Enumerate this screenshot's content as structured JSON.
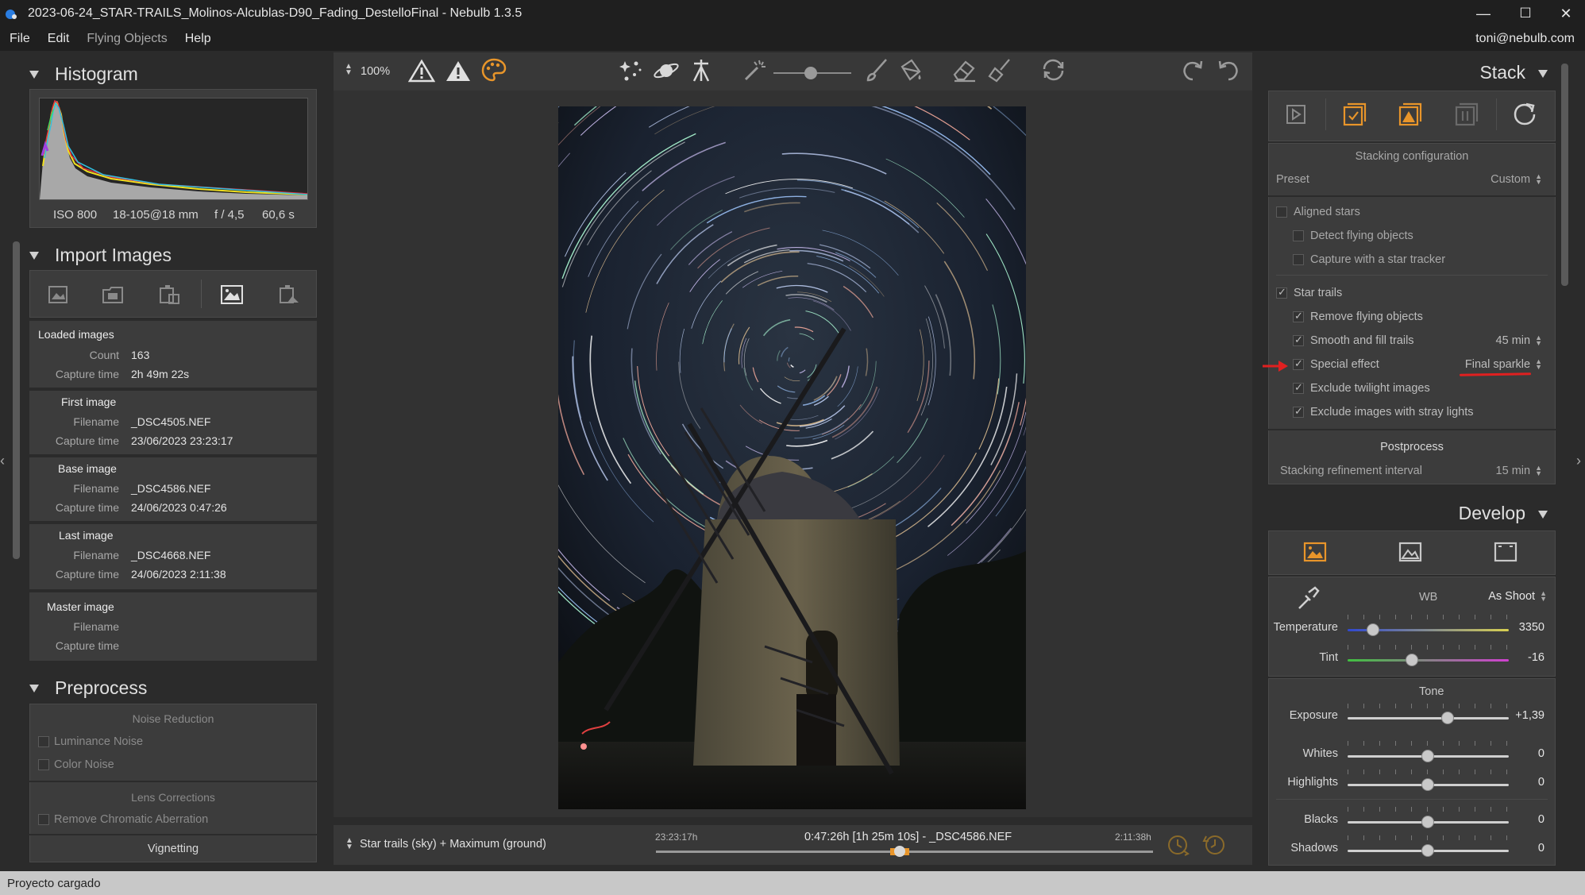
{
  "window": {
    "title": "2023-06-24_STAR-TRAILS_Molinos-Alcublas-D90_Fading_DestelloFinal - Nebulb 1.3.5",
    "minimize": "—",
    "maximize": "☐",
    "close": "✕"
  },
  "menu": {
    "file": "File",
    "edit": "Edit",
    "flying_objects": "Flying Objects",
    "help": "Help",
    "user": "toni@nebulb.com"
  },
  "histogram": {
    "title": "Histogram",
    "iso": "ISO 800",
    "lens": "18-105@18 mm",
    "aperture": "f / 4,5",
    "exposure": "60,6 s"
  },
  "import": {
    "title": "Import Images",
    "loaded": {
      "heading": "Loaded images",
      "count_label": "Count",
      "count": "163",
      "capture_label": "Capture time",
      "capture": "2h 49m 22s"
    },
    "first": {
      "heading": "First image",
      "filename_label": "Filename",
      "filename": "_DSC4505.NEF",
      "capture_label": "Capture time",
      "capture": "23/06/2023 23:23:17"
    },
    "base": {
      "heading": "Base image",
      "filename_label": "Filename",
      "filename": "_DSC4586.NEF",
      "capture_label": "Capture time",
      "capture": "24/06/2023 0:47:26"
    },
    "last": {
      "heading": "Last image",
      "filename_label": "Filename",
      "filename": "_DSC4668.NEF",
      "capture_label": "Capture time",
      "capture": "24/06/2023 2:11:38"
    },
    "master": {
      "heading": "Master image",
      "filename_label": "Filename",
      "capture_label": "Capture time"
    }
  },
  "preprocess": {
    "title": "Preprocess",
    "noise_heading": "Noise Reduction",
    "luminance": "Luminance Noise",
    "color": "Color Noise",
    "lens_heading": "Lens Corrections",
    "chromatic": "Remove Chromatic Aberration",
    "vignetting": "Vignetting"
  },
  "toolbar": {
    "zoom": "100%"
  },
  "bottom": {
    "mode": "Star trails (sky) + Maximum (ground)",
    "start_time": "23:23:17h",
    "current": "0:47:26h [1h 25m 10s] - _DSC4586.NEF",
    "end_time": "2:11:38h",
    "timeline_position": 0.49
  },
  "stack": {
    "title": "Stack",
    "config_heading": "Stacking configuration",
    "preset_label": "Preset",
    "preset_value": "Custom",
    "aligned_stars": "Aligned stars",
    "detect_flying": "Detect flying objects",
    "star_tracker": "Capture with a star tracker",
    "star_trails": "Star trails",
    "remove_flying": "Remove flying objects",
    "smooth_fill": "Smooth and fill trails",
    "smooth_value": "45 min",
    "special_effect": "Special effect",
    "special_value": "Final sparkle",
    "exclude_twilight": "Exclude twilight images",
    "exclude_stray": "Exclude images with stray lights",
    "postprocess_heading": "Postprocess",
    "refinement_label": "Stacking refinement interval",
    "refinement_value": "15 min"
  },
  "develop": {
    "title": "Develop",
    "wb_label": "WB",
    "wb_value": "As Shoot",
    "temperature_label": "Temperature",
    "temperature": "3350",
    "temperature_level": 0.16,
    "tint_label": "Tint",
    "tint": "-16",
    "tint_level": 0.4,
    "tone_heading": "Tone",
    "exposure_label": "Exposure",
    "exposure": "+1,39",
    "exposure_level": 0.62,
    "whites_label": "Whites",
    "whites": "0",
    "highlights_label": "Highlights",
    "highlights": "0",
    "blacks_label": "Blacks",
    "blacks": "0",
    "shadows_label": "Shadows",
    "shadows": "0"
  },
  "status": {
    "text": "Proyecto cargado"
  },
  "colors": {
    "accent": "#e8952a",
    "annotation": "#e02020",
    "panel": "#3c3c3c",
    "background": "#2b2b2b"
  }
}
